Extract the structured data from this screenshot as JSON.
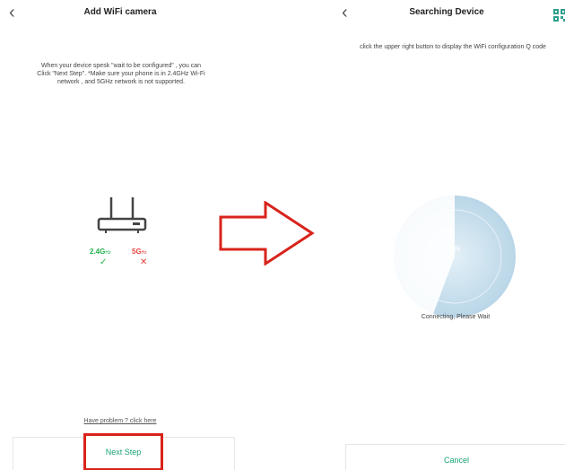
{
  "left_screen": {
    "back_icon": "‹",
    "title": "Add WiFi camera",
    "instructions": "When your device spesk \"wait to be configured\" , you can Click \"Next Step\". *Make sure your phone is in 2.4GHz Wi-Fi network , and 5GHz network is not supported.",
    "band_24": {
      "label": "2.4G",
      "unit": "Hz",
      "status": "✓"
    },
    "band_5": {
      "label": "5G",
      "unit": "Hz",
      "status": "✕"
    },
    "help_link": "Have problem ? click here",
    "next_button": "Next Step"
  },
  "right_screen": {
    "back_icon": "‹",
    "title": "Searching Device",
    "qr_icon": "qr-code-icon",
    "hint": "click the upper right button to display the WiFi configuration Q code",
    "progress_label": "8%",
    "progress": 0.08,
    "status": "Connecting, Please Wait",
    "cancel_button": "Cancel"
  },
  "colors": {
    "accent_green": "#19a374",
    "ok_green": "#22b24c",
    "error_red": "#e0443e",
    "highlight_red": "#d8231b",
    "radar_blue": "#b9d6e8"
  }
}
